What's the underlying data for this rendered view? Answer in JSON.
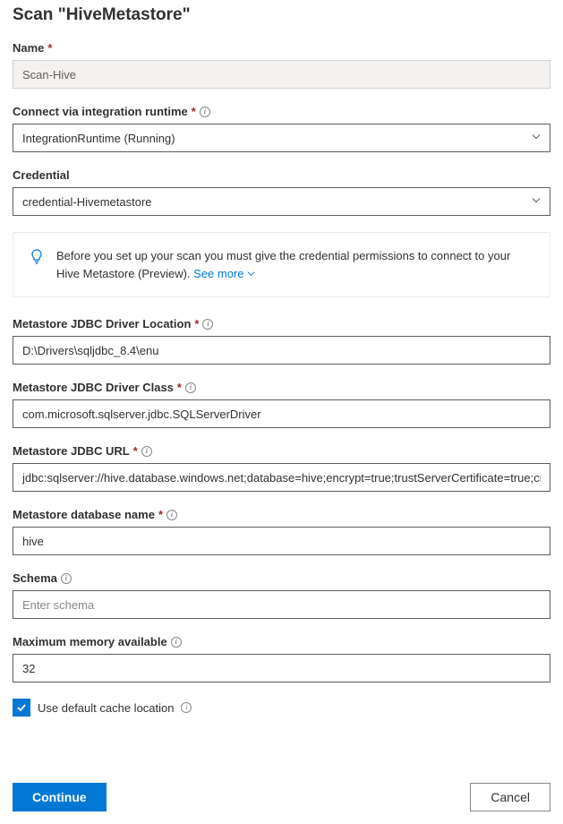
{
  "title": "Scan \"HiveMetastore\"",
  "fields": {
    "name": {
      "label": "Name",
      "value": "Scan-Hive"
    },
    "runtime": {
      "label": "Connect via integration runtime",
      "value": "IntegrationRuntime (Running)"
    },
    "credential": {
      "label": "Credential",
      "value": "credential-Hivemetastore"
    },
    "driverLocation": {
      "label": "Metastore JDBC Driver Location",
      "value": "D:\\Drivers\\sqljdbc_8.4\\enu"
    },
    "driverClass": {
      "label": "Metastore JDBC Driver Class",
      "value": "com.microsoft.sqlserver.jdbc.SQLServerDriver"
    },
    "jdbcUrl": {
      "label": "Metastore JDBC URL",
      "value": "jdbc:sqlserver://hive.database.windows.net;database=hive;encrypt=true;trustServerCertificate=true;create=fal"
    },
    "dbName": {
      "label": "Metastore database name",
      "value": "hive"
    },
    "schema": {
      "label": "Schema",
      "placeholder": "Enter schema"
    },
    "memory": {
      "label": "Maximum memory available",
      "value": "32"
    },
    "cache": {
      "label": "Use default cache location"
    }
  },
  "callout": {
    "text": "Before you set up your scan you must give the credential permissions to connect to your Hive Metastore (Preview). ",
    "seeMore": "See more"
  },
  "buttons": {
    "continue": "Continue",
    "cancel": "Cancel"
  }
}
